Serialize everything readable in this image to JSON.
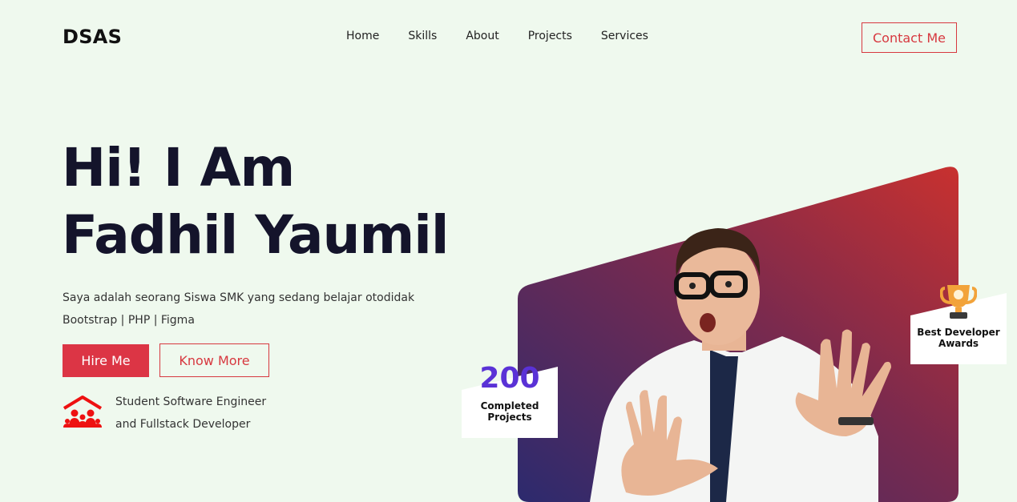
{
  "brand": "DSAS",
  "nav": [
    "Home",
    "Skills",
    "About",
    "Projects",
    "Services"
  ],
  "contact_label": "Contact Me",
  "hero": {
    "title_line1": "Hi! I Am",
    "title_line2": "Fadhil Yaumil",
    "desc_line1": "Saya adalah seorang Siswa SMK yang sedang belajar otodidak",
    "desc_line2": "Bootstrap | PHP | Figma",
    "hire_label": "Hire Me",
    "more_label": "Know More"
  },
  "role": {
    "line1": "Student Software Engineer",
    "line2": "and Fullstack Developer",
    "icon": "family-home-icon"
  },
  "stats": {
    "number": "200",
    "label_line1": "Completed",
    "label_line2": "Projects"
  },
  "award": {
    "line1": "Best Developer",
    "line2": "Awards",
    "icon": "trophy-icon"
  },
  "colors": {
    "background": "#eff9ee",
    "accent": "#dc3545",
    "stat": "#5a32d6",
    "gradient_start": "#2c2a6e",
    "gradient_end": "#c8312f"
  }
}
